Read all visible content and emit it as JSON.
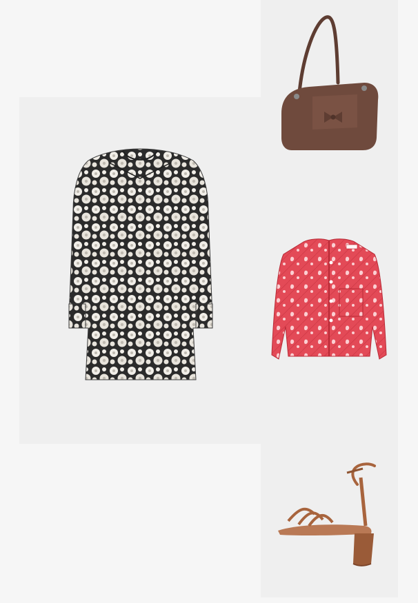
{
  "outfit": {
    "items": [
      {
        "id": "dress",
        "icon": "floral-print-dress-image",
        "colors": {
          "base": "#2b2b2b",
          "print": "#f1eee8"
        }
      },
      {
        "id": "bag",
        "icon": "brown-shoulder-bag-image",
        "colors": {
          "base": "#6f4a3d"
        }
      },
      {
        "id": "jacket",
        "icon": "red-quilted-jacket-image",
        "colors": {
          "base": "#e34a57",
          "print": "#ffe6e8"
        }
      },
      {
        "id": "sandal",
        "icon": "tan-strappy-block-heel-sandal-image",
        "colors": {
          "base": "#a8643d"
        }
      }
    ]
  }
}
